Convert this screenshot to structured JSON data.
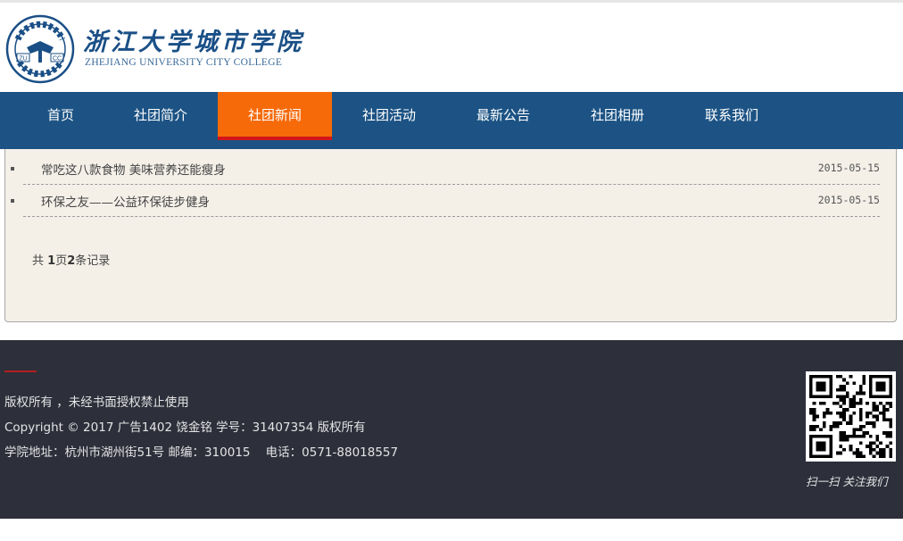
{
  "header": {
    "logo_cn": "浙江大学城市学院",
    "logo_en": "ZHEJIANG UNIVERSITY CITY COLLEGE",
    "emblem_text_left": "ZU",
    "emblem_text_right": "CC"
  },
  "nav": {
    "items": [
      {
        "label": "首页"
      },
      {
        "label": "社团简介"
      },
      {
        "label": "社团新闻"
      },
      {
        "label": "社团活动"
      },
      {
        "label": "最新公告"
      },
      {
        "label": "社团相册"
      },
      {
        "label": "联系我们"
      }
    ],
    "active_label": "社团新闻"
  },
  "news": {
    "items": [
      {
        "title": "常吃这八款食物 美味营养还能瘦身",
        "date": "2015-05-15"
      },
      {
        "title": "环保之友——公益环保徒步健身",
        "date": "2015-05-15"
      }
    ],
    "pager": {
      "prefix": "共 ",
      "pages": "1",
      "pages_unit": "页",
      "records": "2",
      "records_unit": "条记录"
    }
  },
  "footer": {
    "rights": "版权所有 ，未经书面授权禁止使用",
    "copyright": "Copyright © 2017 广告1402 饶金铭 学号：31407354 版权所有",
    "address": "学院地址：杭州市湖州街51号 邮编：310015    电话：0571-88018557",
    "qr_caption": "扫一扫 关注我们"
  },
  "colors": {
    "nav_bg": "#1c5384",
    "nav_active": "#f66a0a",
    "nav_active_underline": "#d0161b",
    "panel_bg": "#f4f0e8",
    "footer_bg": "#2d2f3b"
  }
}
